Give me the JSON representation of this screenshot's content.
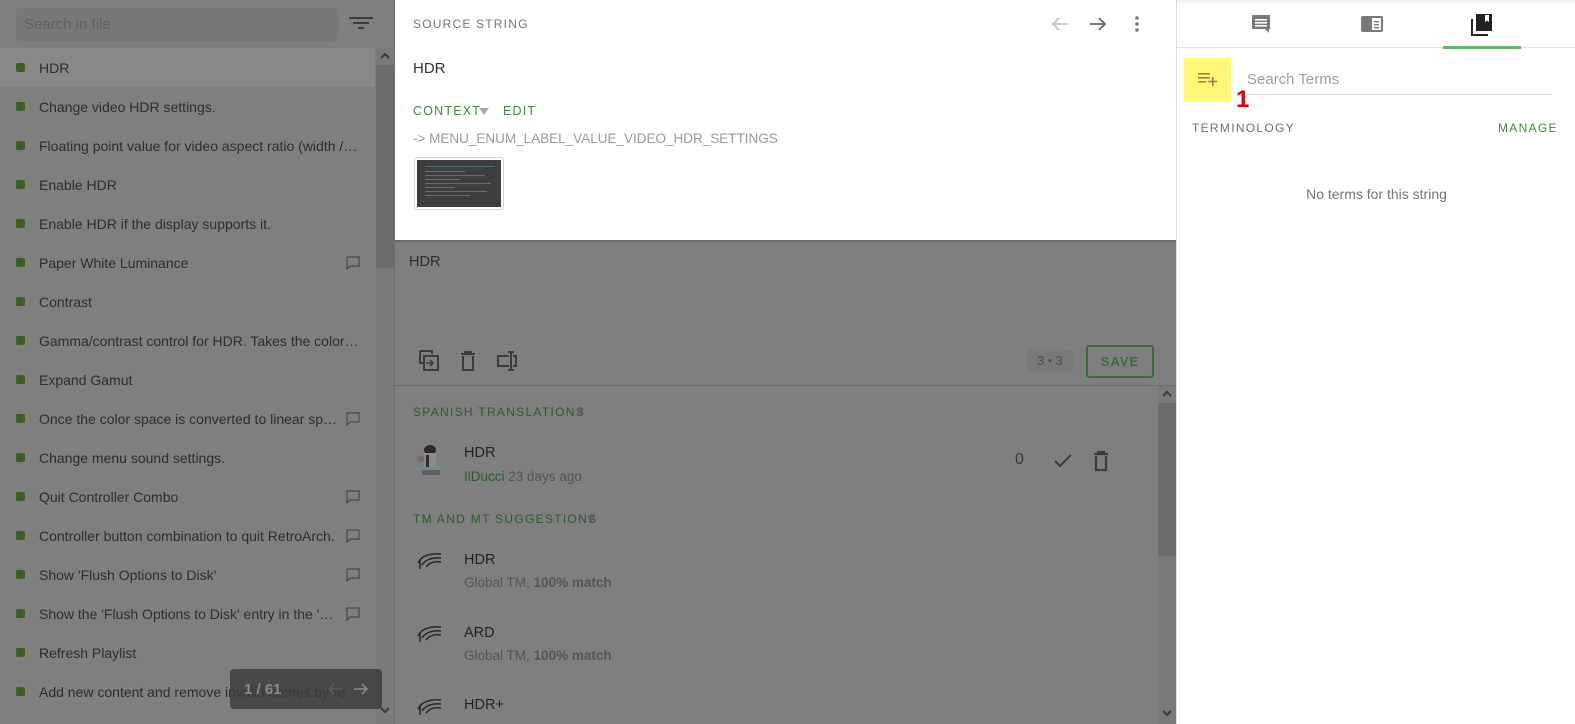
{
  "left_panel": {
    "search_placeholder": "Search in file",
    "items": [
      {
        "text": "HDR",
        "active": true,
        "has_comment": false
      },
      {
        "text": "Change video HDR settings.",
        "has_comment": false
      },
      {
        "text": "Floating point value for video aspect ratio (width / height)",
        "has_comment": false
      },
      {
        "text": "Enable HDR",
        "has_comment": false
      },
      {
        "text": "Enable HDR if the display supports it.",
        "has_comment": false
      },
      {
        "text": "Paper White Luminance",
        "has_comment": true
      },
      {
        "text": "Contrast",
        "has_comment": false
      },
      {
        "text": "Gamma/contrast control for HDR. Takes the colors and increases the overall range",
        "has_comment": false
      },
      {
        "text": "Expand Gamut",
        "has_comment": false
      },
      {
        "text": "Once the color space is converted to linear space, decide whether",
        "has_comment": true
      },
      {
        "text": "Change menu sound settings.",
        "has_comment": false
      },
      {
        "text": "Quit Controller Combo",
        "has_comment": true
      },
      {
        "text": "Controller button combination to quit RetroArch.",
        "has_comment": true
      },
      {
        "text": "Show 'Flush Options to Disk'",
        "has_comment": true
      },
      {
        "text": "Show the 'Flush Options to Disk' entry in the 'Options' menu",
        "has_comment": true
      },
      {
        "text": "Refresh Playlist",
        "has_comment": false
      },
      {
        "text": "Add new content and remove invalid entries by repeating",
        "has_comment": false
      }
    ],
    "pager": {
      "count": "1 / 61"
    }
  },
  "source": {
    "label": "SOURCE STRING",
    "text": "HDR",
    "context_tab": "CONTEXT",
    "edit_tab": "EDIT",
    "context_key": "-> MENU_ENUM_LABEL_VALUE_VIDEO_HDR_SETTINGS"
  },
  "editor": {
    "value": "HDR",
    "counter": "3 • 3",
    "save_label": "SAVE"
  },
  "translations": {
    "section_title": "SPANISH TRANSLATIONS",
    "items": [
      {
        "text": "HDR",
        "user": "IlDucci",
        "time": "23 days ago",
        "votes": "0"
      }
    ],
    "suggestions_title": "TM AND MT SUGGESTIONS",
    "suggestions": [
      {
        "text": "HDR",
        "source": "Global TM,",
        "match": "100% match"
      },
      {
        "text": "ARD",
        "source": "Global TM,",
        "match": "100% match"
      },
      {
        "text": "HDR+",
        "source": "",
        "match": ""
      }
    ]
  },
  "right_panel": {
    "tabs": [
      {
        "name": "comments",
        "active": false
      },
      {
        "name": "resources",
        "active": false
      },
      {
        "name": "terminology",
        "active": true
      }
    ],
    "search_placeholder": "Search Terms",
    "annotation_number": "1",
    "terminology_label": "TERMINOLOGY",
    "manage_label": "MANAGE",
    "empty_text": "No terms for this string"
  },
  "colors": {
    "accent_green": "#3c8a3c",
    "tab_underline": "#66b366",
    "highlight_yellow": "#fff77a",
    "annotation_red": "#e00000"
  }
}
